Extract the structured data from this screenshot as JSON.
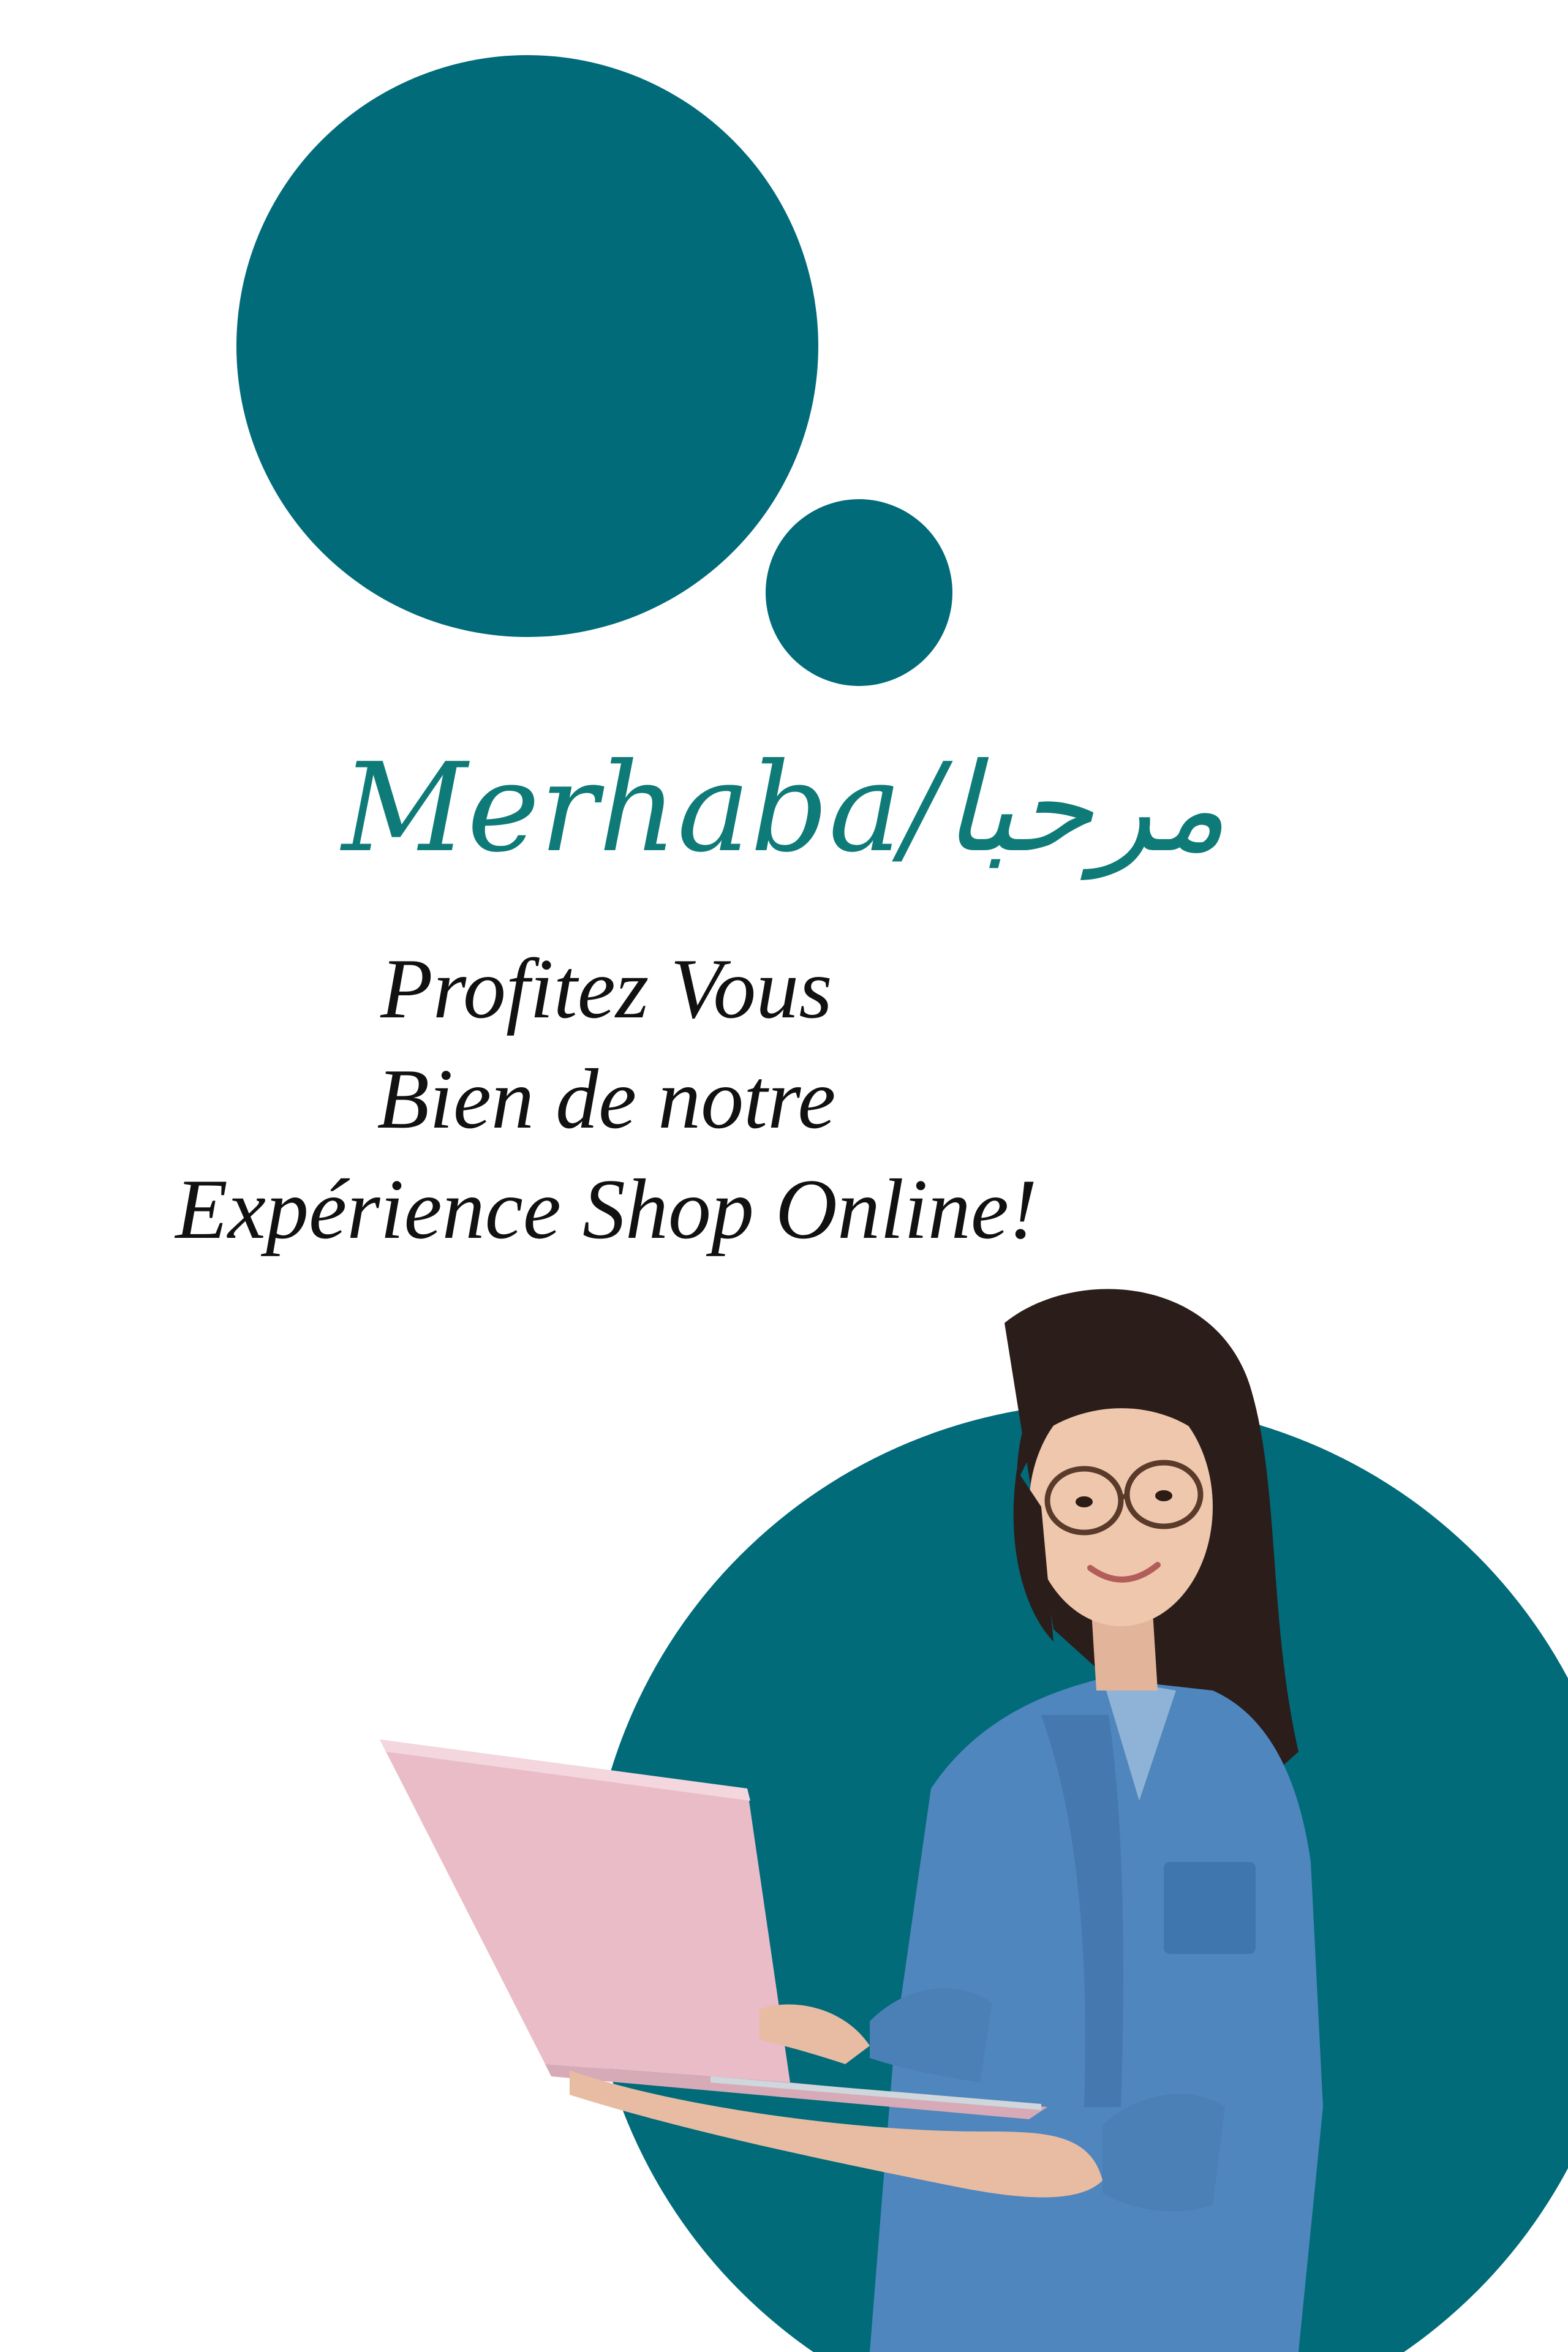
{
  "headline": {
    "latin": "Merhaba/",
    "arabic": "مرحبا"
  },
  "tagline": {
    "line1": "Profitez Vous",
    "line2": "Bien de notre",
    "line3": "Expérience Shop Online!"
  },
  "colors": {
    "brand_teal": "#016b7a",
    "headline_teal": "#0f7b78",
    "text_dark": "#111111",
    "background": "#ffffff"
  },
  "image": {
    "subject": "woman-with-laptop-photo"
  }
}
